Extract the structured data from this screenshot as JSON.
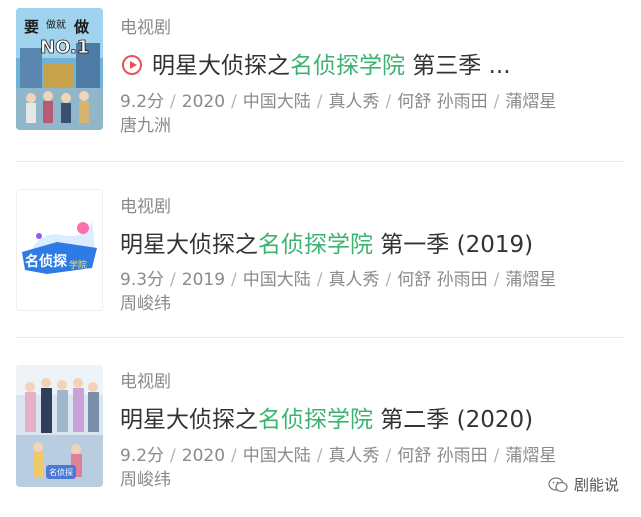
{
  "results": [
    {
      "category": "电视剧",
      "title_prefix": "明星大侦探之",
      "title_highlight": "名侦探学院",
      "title_suffix": " 第三季 ...",
      "has_play_icon": true,
      "meta": {
        "rating": "9.2分",
        "year": "2020",
        "region": "中国大陆",
        "genre": "真人秀",
        "cast_line1": "何舒 孙雨田",
        "cast_line1_tail": "蒲熠星",
        "cast_line2": "唐九洲"
      },
      "poster_icon": "poster-image"
    },
    {
      "category": "电视剧",
      "title_prefix": "明星大侦探之",
      "title_highlight": "名侦探学院",
      "title_suffix": " 第一季 (2019)",
      "has_play_icon": false,
      "meta": {
        "rating": "9.3分",
        "year": "2019",
        "region": "中国大陆",
        "genre": "真人秀",
        "cast_line1": "何舒 孙雨田",
        "cast_line1_tail": "蒲熠星",
        "cast_line2": "周峻纬"
      },
      "poster_icon": "poster-image"
    },
    {
      "category": "电视剧",
      "title_prefix": "明星大侦探之",
      "title_highlight": "名侦探学院",
      "title_suffix": " 第二季 (2020)",
      "has_play_icon": false,
      "meta": {
        "rating": "9.2分",
        "year": "2020",
        "region": "中国大陆",
        "genre": "真人秀",
        "cast_line1": "何舒 孙雨田",
        "cast_line1_tail": "蒲熠星",
        "cast_line2": "周峻纬"
      },
      "poster_icon": "poster-image"
    }
  ],
  "watermark": {
    "icon": "wechat-icon",
    "text": "剧能说"
  },
  "colors": {
    "highlight": "#3cb371",
    "play_icon": "#e8505b",
    "meta_text": "#8a8a8a"
  }
}
